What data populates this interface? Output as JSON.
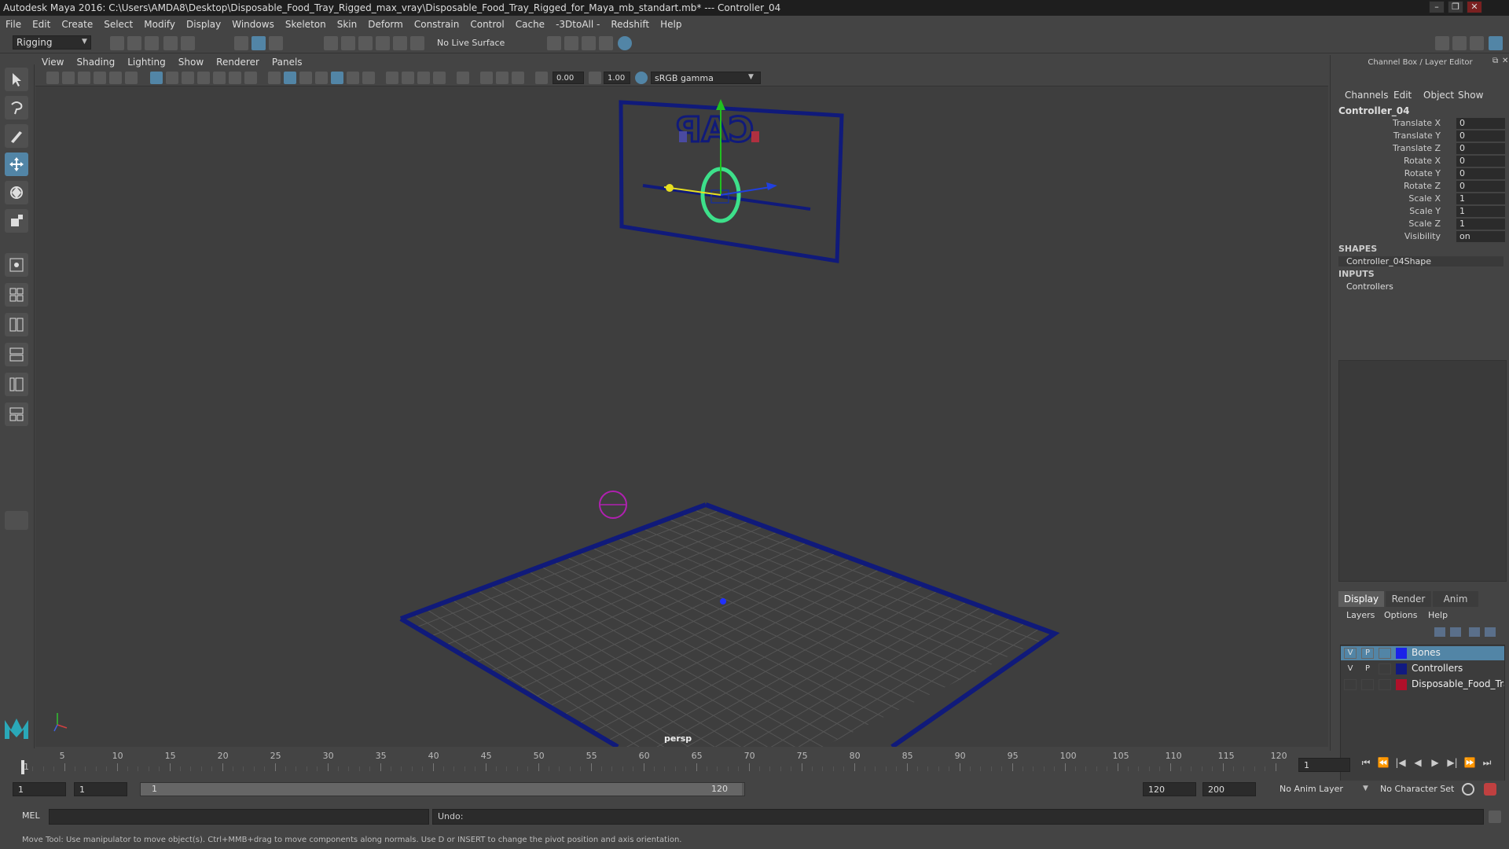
{
  "window": {
    "title": "Autodesk Maya 2016: C:\\Users\\AMDA8\\Desktop\\Disposable_Food_Tray_Rigged_max_vray\\Disposable_Food_Tray_Rigged_for_Maya_mb_standart.mb*  ---  Controller_04",
    "controls": [
      "–",
      "❐",
      "✕"
    ]
  },
  "menubar": [
    "File",
    "Edit",
    "Create",
    "Select",
    "Modify",
    "Display",
    "Windows",
    "Skeleton",
    "Skin",
    "Deform",
    "Constrain",
    "Control",
    "Cache",
    "-3DtoAll -",
    "Redshift",
    "Help"
  ],
  "shelf": {
    "mode": "Rigging",
    "live_surface": "No Live Surface"
  },
  "viewport": {
    "menu": [
      "View",
      "Shading",
      "Lighting",
      "Show",
      "Renderer",
      "Panels"
    ],
    "exposure": "0.00",
    "gamma": "1.00",
    "color_space": "sRGB gamma",
    "camera_label": "persp",
    "sign_text": "CAP"
  },
  "channel_box": {
    "title": "Channel Box / Layer Editor",
    "menu": [
      "Channels",
      "Edit",
      "Object",
      "Show"
    ],
    "object": "Controller_04",
    "attributes": [
      {
        "label": "Translate X",
        "value": "0"
      },
      {
        "label": "Translate Y",
        "value": "0"
      },
      {
        "label": "Translate Z",
        "value": "0"
      },
      {
        "label": "Rotate X",
        "value": "0"
      },
      {
        "label": "Rotate Y",
        "value": "0"
      },
      {
        "label": "Rotate Z",
        "value": "0"
      },
      {
        "label": "Scale X",
        "value": "1"
      },
      {
        "label": "Scale Y",
        "value": "1"
      },
      {
        "label": "Scale Z",
        "value": "1"
      },
      {
        "label": "Visibility",
        "value": "on"
      }
    ],
    "shapes_header": "SHAPES",
    "shape": "Controller_04Shape",
    "inputs_header": "INPUTS",
    "input": "Controllers"
  },
  "layer_editor": {
    "tabs": [
      "Display",
      "Render",
      "Anim"
    ],
    "menu": [
      "Layers",
      "Options",
      "Help"
    ],
    "layers": [
      {
        "v": "V",
        "p": "P",
        "color": "#1a22e8",
        "name": "Bones",
        "selected": true
      },
      {
        "v": "V",
        "p": "P",
        "color": "#111a80",
        "name": "Controllers",
        "selected": false
      },
      {
        "v": "",
        "p": "",
        "color": "#b0102a",
        "name": "Disposable_Food_Tray",
        "selected": false
      }
    ]
  },
  "timeline": {
    "ticks": [
      "1",
      "5",
      "10",
      "15",
      "20",
      "25",
      "30",
      "35",
      "40",
      "45",
      "50",
      "55",
      "60",
      "65",
      "70",
      "75",
      "80",
      "85",
      "90",
      "95",
      "100",
      "105",
      "110",
      "115",
      "120"
    ],
    "current_frame": "1",
    "transport": [
      "⏮",
      "⏪",
      "|◀",
      "◀",
      "▶",
      "▶|",
      "⏩",
      "⏭"
    ]
  },
  "range": {
    "start": "1",
    "playback_start": "1",
    "slider_start": "1",
    "slider_end": "120",
    "playback_end": "120",
    "end": "200",
    "anim_layer": "No Anim Layer",
    "character_set": "No Character Set"
  },
  "command": {
    "lang": "MEL",
    "result": "Undo:"
  },
  "help_line": "Move Tool: Use manipulator to move object(s). Ctrl+MMB+drag to move components along normals. Use D or INSERT to change the pivot position and axis orientation.",
  "colors": {
    "accent": "#5285a6",
    "wire": "#1a1a80",
    "selected_ctrl": "#3de08a"
  }
}
